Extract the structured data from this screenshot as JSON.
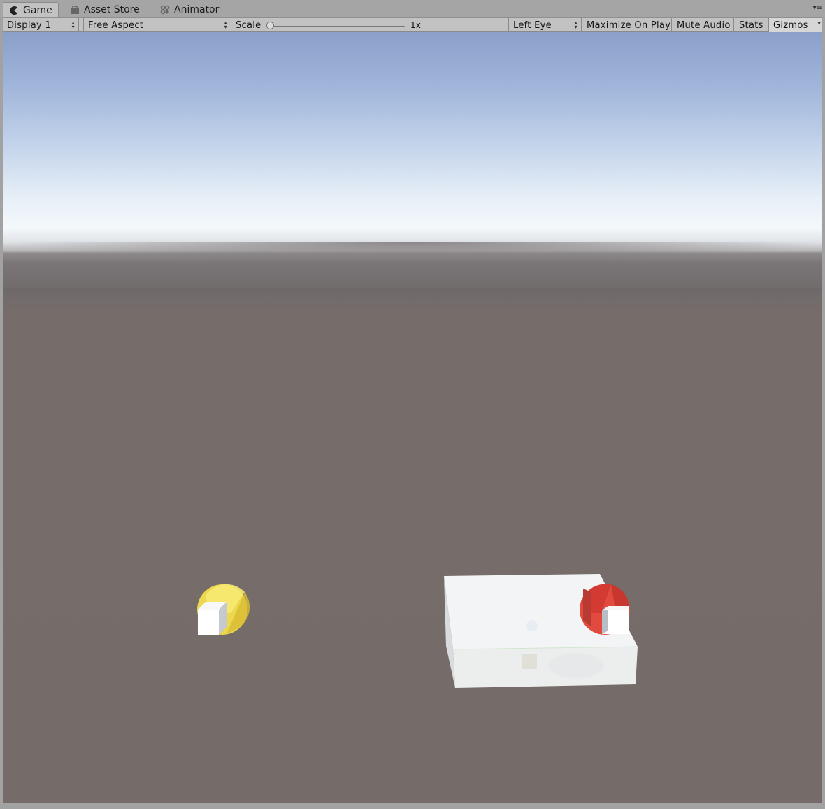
{
  "tabs": [
    {
      "label": "Game",
      "icon": "pacman-icon",
      "active": true
    },
    {
      "label": "Asset Store",
      "icon": "shopping-bag-icon",
      "active": false
    },
    {
      "label": "Animator",
      "icon": "animator-icon",
      "active": false
    }
  ],
  "panel_menu": "▾≡",
  "toolbar": {
    "display": "Display 1",
    "aspect": "Free Aspect",
    "scale_label": "Scale",
    "scale_value": "1x",
    "eye": "Left Eye",
    "maximize": "Maximize On Play",
    "mute": "Mute Audio",
    "stats": "Stats",
    "gizmos": "Gizmos"
  },
  "scene": {
    "sky_top_color": "#8aa0c8",
    "horizon_color": "#f4f8fb",
    "ground_color": "#756c6a",
    "objects": [
      {
        "name": "yellow-sphere-with-cube",
        "color": "#ecd84f"
      },
      {
        "name": "white-box-platform",
        "color": "#f2f3f4"
      },
      {
        "name": "red-sphere-with-cube",
        "color": "#e04a3f"
      }
    ]
  }
}
